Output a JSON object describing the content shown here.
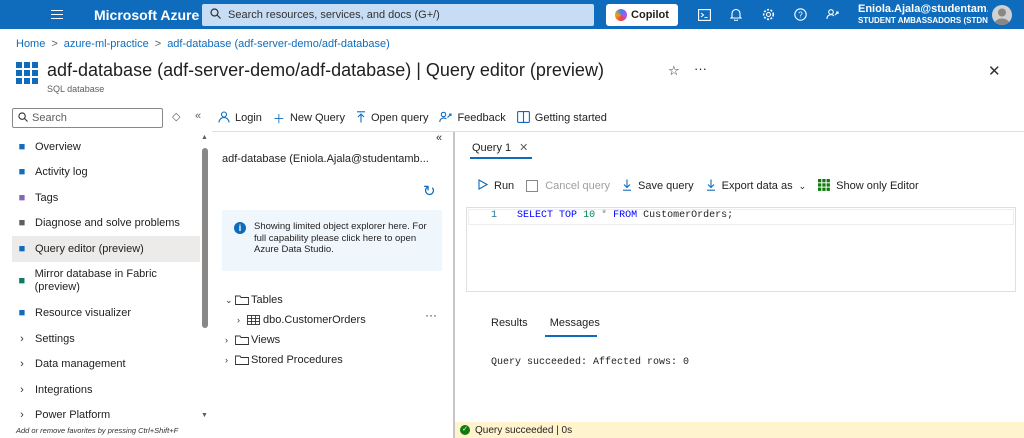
{
  "topbar": {
    "brand": "Microsoft Azure",
    "search_placeholder": "Search resources, services, and docs (G+/)",
    "copilot_label": "Copilot",
    "user_name": "Eniola.Ajala@studentam...",
    "user_tenant": "STUDENT AMBASSADORS (STDN...",
    "icons": [
      "cloud-shell-icon",
      "bell-icon",
      "gear-icon",
      "help-icon",
      "feedback-icon"
    ]
  },
  "breadcrumb": [
    "Home",
    "azure-ml-practice",
    "adf-database (adf-server-demo/adf-database)"
  ],
  "header": {
    "title": "adf-database (adf-server-demo/adf-database) | Query editor (preview)",
    "subtitle": "SQL database"
  },
  "sidebar": {
    "search_placeholder": "Search",
    "items": [
      {
        "label": "Overview",
        "icon": "sql-icon",
        "color": "#0f6cbd"
      },
      {
        "label": "Activity log",
        "icon": "activity-log-icon",
        "color": "#0f6cbd"
      },
      {
        "label": "Tags",
        "icon": "tag-icon",
        "color": "#8764b8"
      },
      {
        "label": "Diagnose and solve problems",
        "icon": "wrench-icon",
        "color": "#605e5c"
      },
      {
        "label": "Query editor (preview)",
        "icon": "query-editor-icon",
        "color": "#0f6cbd",
        "active": true
      },
      {
        "label": "Mirror database in Fabric (preview)",
        "icon": "fabric-icon",
        "color": "#117865"
      },
      {
        "label": "Resource visualizer",
        "icon": "visualizer-icon",
        "color": "#0f6cbd"
      },
      {
        "label": "Settings",
        "chevron": true
      },
      {
        "label": "Data management",
        "chevron": true
      },
      {
        "label": "Integrations",
        "chevron": true
      },
      {
        "label": "Power Platform",
        "chevron": true
      }
    ],
    "hint": "Add or remove favorites by pressing Ctrl+Shift+F"
  },
  "toolbar": {
    "login": "Login",
    "new_query": "New Query",
    "open_query": "Open query",
    "feedback": "Feedback",
    "getting_started": "Getting started"
  },
  "explorer": {
    "connection": "adf-database (Eniola.Ajala@studentamb...",
    "info": "Showing limited object explorer here. For full capability please click here to open Azure Data Studio.",
    "tables": "Tables",
    "table_item": "dbo.CustomerOrders",
    "views": "Views",
    "procedures": "Stored Procedures"
  },
  "query": {
    "tab_label": "Query 1",
    "run": "Run",
    "cancel": "Cancel query",
    "save": "Save query",
    "export": "Export data as",
    "show_only": "Show only Editor",
    "line_number": "1",
    "code": {
      "k1": "SELECT",
      "k2": "TOP",
      "n": "10",
      "op": "*",
      "k3": "FROM",
      "ident": "CustomerOrders;"
    }
  },
  "results": {
    "tab_results": "Results",
    "tab_messages": "Messages",
    "message": "Query succeeded: Affected rows: 0"
  },
  "status": {
    "text": "Query succeeded | 0s",
    "color": "#fff4ce"
  }
}
